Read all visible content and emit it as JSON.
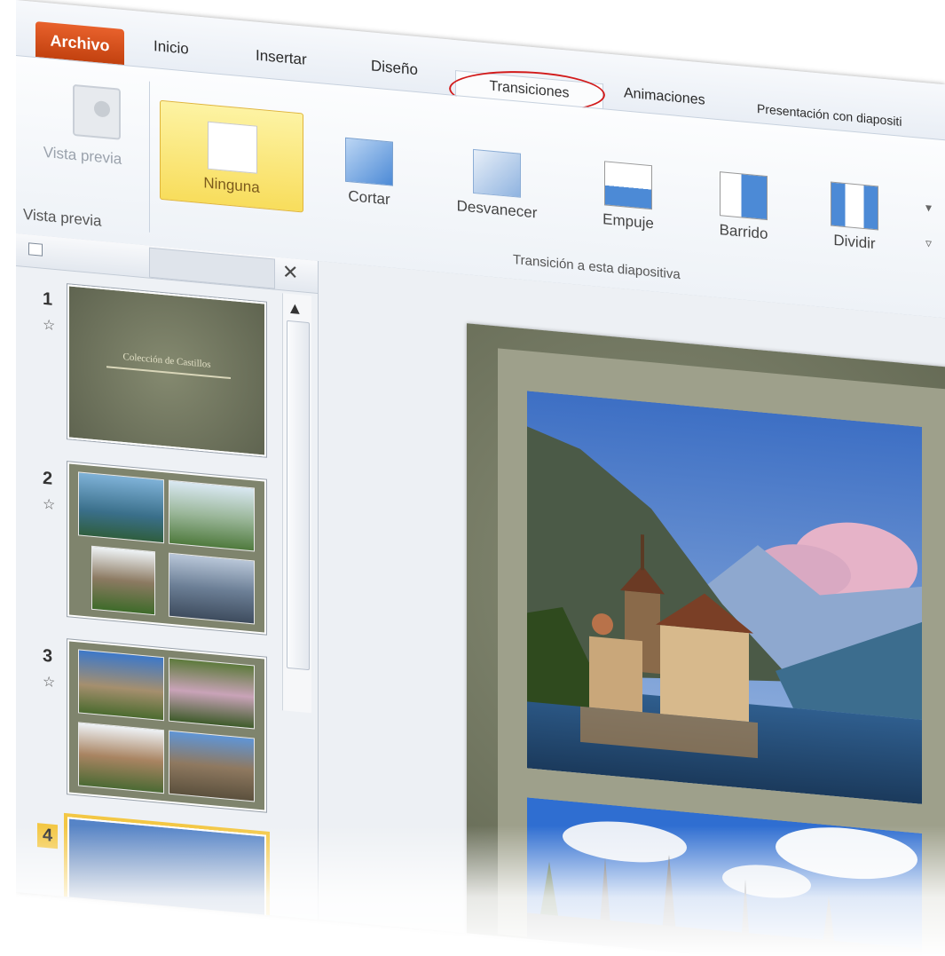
{
  "tabs": {
    "file": "Archivo",
    "home": "Inicio",
    "insert": "Insertar",
    "design": "Diseño",
    "transitions": "Transiciones",
    "animations": "Animaciones",
    "slideshow": "Presentación con diapositi"
  },
  "ribbon": {
    "preview_button": "Vista previa",
    "preview_group": "Vista previa",
    "transitions": [
      {
        "label": "Ninguna",
        "selected": true
      },
      {
        "label": "Cortar"
      },
      {
        "label": "Desvanecer"
      },
      {
        "label": "Empuje"
      },
      {
        "label": "Barrido"
      },
      {
        "label": "Dividir"
      }
    ],
    "group_label": "Transición a esta diapositiva"
  },
  "slides": [
    {
      "number": "1",
      "title_thumb": "Colección de Castillos"
    },
    {
      "number": "2"
    },
    {
      "number": "3"
    },
    {
      "number": "4",
      "selected": true
    }
  ],
  "colors": {
    "file_tab": "#c2410f",
    "selected_gallery": "#f8dd5c",
    "highlight_circle": "#d21a1a",
    "slide_frame": "#6b705a"
  }
}
